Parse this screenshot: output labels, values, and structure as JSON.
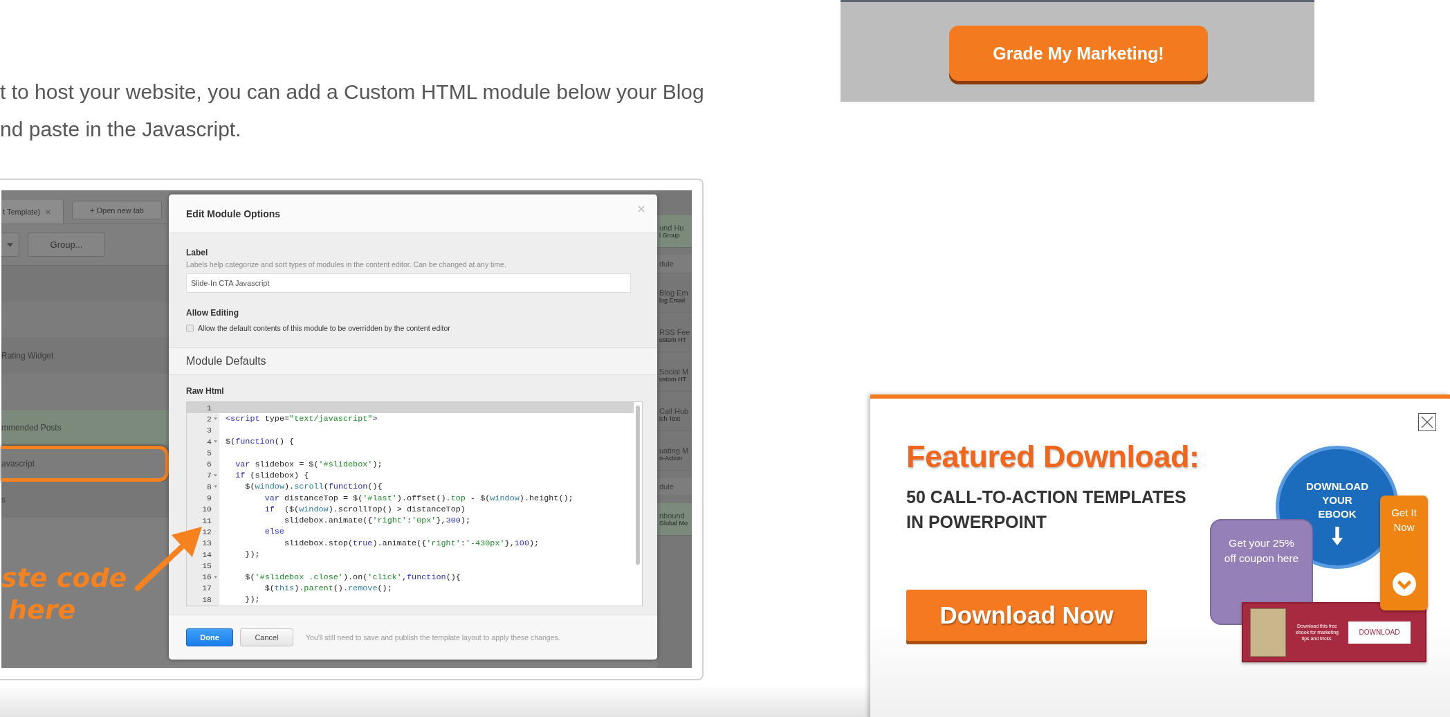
{
  "article": {
    "paragraph_lines": [
      "t to host your website, you can add a Custom HTML module below your Blog",
      "nd paste in the Javascript."
    ]
  },
  "screenshot": {
    "left_panel": {
      "tab": {
        "label": "t Template)"
      },
      "open_tab_button": "+ Open new tab",
      "group_button": "Group...",
      "rows": [
        {
          "tinted": false,
          "circled": false
        },
        {
          "tinted": false,
          "circled": false
        },
        {
          "label": "Rating Widget",
          "tinted": false,
          "circled": false
        },
        {
          "tinted": false,
          "circled": false
        },
        {
          "label": "mmended Posts",
          "tinted": true,
          "circled": false
        },
        {
          "label": "avascript",
          "tinted": false,
          "circled": true
        },
        {
          "label": "s",
          "tinted": false,
          "circled": false
        }
      ],
      "annotation_lines": [
        "ste code",
        "here"
      ]
    },
    "dialog": {
      "title": "Edit Module Options",
      "label_heading": "Label",
      "label_hint": "Labels help categorize and sort types of modules in the content editor. Can be changed at any time.",
      "label_value": "Slide-In CTA Javascript",
      "editing_heading": "Allow Editing",
      "editing_option": {
        "label": "Allow the default contents of this module to be overridden by the content editor",
        "checked": false
      },
      "section_title": "Module Defaults",
      "code_heading": "Raw Html",
      "code_lines": [
        {
          "number": "1",
          "fold": false,
          "current": true
        },
        {
          "number": "2",
          "fold": true,
          "current": false,
          "tokens": [
            {
              "text": "<script",
              "kind": "tag"
            },
            {
              "text": " type=",
              "kind": "plain"
            },
            {
              "text": "\"text/javascript\"",
              "kind": "string"
            },
            {
              "text": ">",
              "kind": "tag"
            }
          ]
        },
        {
          "number": "3",
          "fold": false,
          "current": false
        },
        {
          "number": "4",
          "fold": true,
          "current": false,
          "tokens": [
            {
              "text": "$(",
              "kind": "plain"
            },
            {
              "text": "function",
              "kind": "keyword"
            },
            {
              "text": "() {",
              "kind": "plain"
            }
          ]
        },
        {
          "number": "5",
          "fold": false,
          "current": false
        },
        {
          "number": "6",
          "fold": false,
          "current": false,
          "tokens": [
            {
              "text": "  var",
              "kind": "keyword"
            },
            {
              "text": " slidebox = $(",
              "kind": "plain"
            },
            {
              "text": "'#slidebox'",
              "kind": "string"
            },
            {
              "text": ");",
              "kind": "plain"
            }
          ]
        },
        {
          "number": "7",
          "fold": true,
          "current": false,
          "tokens": [
            {
              "text": "  if",
              "kind": "keyword"
            },
            {
              "text": " (slidebox) {",
              "kind": "plain"
            }
          ]
        },
        {
          "number": "8",
          "fold": true,
          "current": false,
          "tokens": [
            {
              "text": "    $(",
              "kind": "plain"
            },
            {
              "text": "window",
              "kind": "name"
            },
            {
              "text": ").",
              "kind": "plain"
            },
            {
              "text": "scroll",
              "kind": "name"
            },
            {
              "text": "(",
              "kind": "plain"
            },
            {
              "text": "function",
              "kind": "keyword"
            },
            {
              "text": "(){",
              "kind": "plain"
            }
          ]
        },
        {
          "number": "9",
          "fold": false,
          "current": false,
          "tokens": [
            {
              "text": "        var",
              "kind": "keyword"
            },
            {
              "text": " distanceTop = $(",
              "kind": "plain"
            },
            {
              "text": "'#last'",
              "kind": "string"
            },
            {
              "text": ").offset().",
              "kind": "plain"
            },
            {
              "text": "top",
              "kind": "string"
            },
            {
              "text": " - $(",
              "kind": "plain"
            },
            {
              "text": "window",
              "kind": "name"
            },
            {
              "text": ").height();",
              "kind": "plain"
            }
          ]
        },
        {
          "number": "10",
          "fold": false,
          "current": false,
          "tokens": [
            {
              "text": "        if",
              "kind": "keyword"
            },
            {
              "text": "  ($(",
              "kind": "plain"
            },
            {
              "text": "window",
              "kind": "name"
            },
            {
              "text": ").scrollTop() > distanceTop)",
              "kind": "plain"
            }
          ]
        },
        {
          "number": "11",
          "fold": false,
          "current": false,
          "tokens": [
            {
              "text": "            slidebox.animate({",
              "kind": "plain"
            },
            {
              "text": "'right'",
              "kind": "string"
            },
            {
              "text": ":",
              "kind": "plain"
            },
            {
              "text": "'0px'",
              "kind": "string"
            },
            {
              "text": "},",
              "kind": "plain"
            },
            {
              "text": "300",
              "kind": "number"
            },
            {
              "text": ");",
              "kind": "plain"
            }
          ]
        },
        {
          "number": "12",
          "fold": false,
          "current": false,
          "tokens": [
            {
              "text": "        else",
              "kind": "keyword"
            }
          ]
        },
        {
          "number": "13",
          "fold": false,
          "current": false,
          "tokens": [
            {
              "text": "            slidebox.stop(",
              "kind": "plain"
            },
            {
              "text": "true",
              "kind": "keyword"
            },
            {
              "text": ").animate({",
              "kind": "plain"
            },
            {
              "text": "'right'",
              "kind": "string"
            },
            {
              "text": ":",
              "kind": "plain"
            },
            {
              "text": "'-430px'",
              "kind": "string"
            },
            {
              "text": "},",
              "kind": "plain"
            },
            {
              "text": "100",
              "kind": "number"
            },
            {
              "text": ");",
              "kind": "plain"
            }
          ]
        },
        {
          "number": "14",
          "fold": false,
          "current": false,
          "tokens": [
            {
              "text": "    });",
              "kind": "plain"
            }
          ]
        },
        {
          "number": "15",
          "fold": false,
          "current": false
        },
        {
          "number": "16",
          "fold": true,
          "current": false,
          "tokens": [
            {
              "text": "    $(",
              "kind": "plain"
            },
            {
              "text": "'#slidebox .close'",
              "kind": "string"
            },
            {
              "text": ").on(",
              "kind": "plain"
            },
            {
              "text": "'click'",
              "kind": "string"
            },
            {
              "text": ",",
              "kind": "plain"
            },
            {
              "text": "function",
              "kind": "keyword"
            },
            {
              "text": "(){",
              "kind": "plain"
            }
          ]
        },
        {
          "number": "17",
          "fold": false,
          "current": false,
          "tokens": [
            {
              "text": "        $(",
              "kind": "plain"
            },
            {
              "text": "this",
              "kind": "name"
            },
            {
              "text": ").",
              "kind": "plain"
            },
            {
              "text": "parent",
              "kind": "string"
            },
            {
              "text": "().",
              "kind": "plain"
            },
            {
              "text": "remove",
              "kind": "name"
            },
            {
              "text": "();",
              "kind": "plain"
            }
          ]
        },
        {
          "number": "18",
          "fold": false,
          "current": false,
          "tokens": [
            {
              "text": "    });",
              "kind": "plain"
            }
          ]
        }
      ],
      "done_button": "Done",
      "cancel_button": "Cancel",
      "footer_note": "You'll still need to save and publish the template layout to apply these changes."
    },
    "right_panel": {
      "items": [
        {
          "title": "und Hu",
          "subtitle": "l Group",
          "tinted": true
        },
        {
          "title": "dule",
          "tinted": false
        },
        {
          "title": "Blog Em",
          "subtitle": "log Email",
          "tinted": false
        },
        {
          "title": "RSS Fee",
          "subtitle": "ustom HT",
          "tinted": false
        },
        {
          "title": "Social M",
          "subtitle": "ustom HT",
          "tinted": false
        },
        {
          "title": "Call Hub",
          "subtitle": "ich Text",
          "tinted": false
        },
        {
          "title": "uating M",
          "subtitle": "n-Action",
          "tinted": false
        },
        {
          "title": "dule",
          "tinted": false
        },
        {
          "title": "nbound",
          "subtitle": "Global Mo",
          "tinted": true
        }
      ]
    }
  },
  "grader_banner": {
    "button": "Grade My Marketing!"
  },
  "featured_popup": {
    "heading": "Featured Download:",
    "subtitle_lines": [
      "50 CALL-TO-ACTION TEMPLATES",
      "IN POWERPOINT"
    ],
    "button": "Download Now",
    "samples": {
      "circle_text": "DOWNLOAD YOUR EBOOK",
      "coupon_text": "Get your 25% off coupon here",
      "tab_text": "Get It Now",
      "banner_text": "Download this free ebook for marketing tips and tricks.",
      "banner_button": "DOWNLOAD"
    }
  }
}
